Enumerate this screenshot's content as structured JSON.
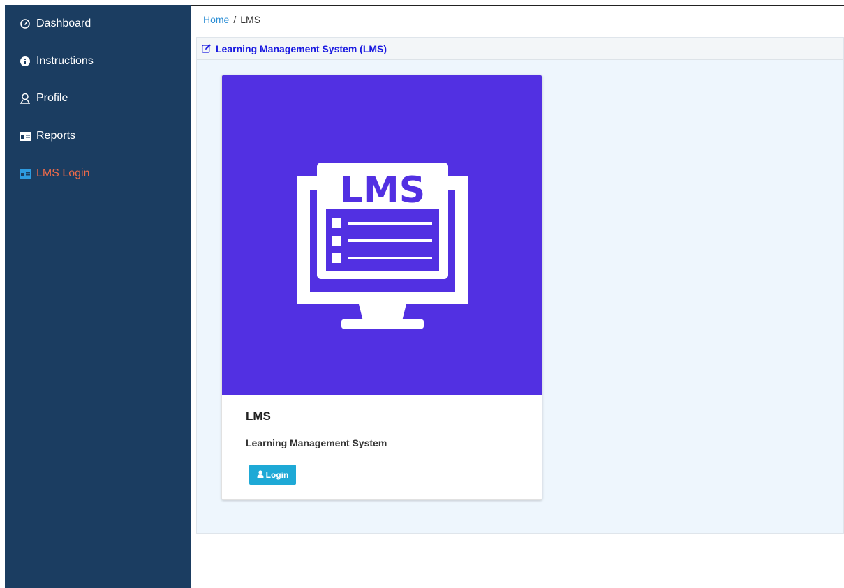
{
  "sidebar": {
    "items": [
      {
        "label": "Dashboard",
        "icon": "dashboard-icon"
      },
      {
        "label": "Instructions",
        "icon": "info-icon"
      },
      {
        "label": "Profile",
        "icon": "user-icon"
      },
      {
        "label": "Reports",
        "icon": "id-card-icon"
      },
      {
        "label": "LMS Login",
        "icon": "id-card-icon",
        "active": true
      }
    ],
    "active_color": "#ef6b4a",
    "background": "#1b3d61"
  },
  "breadcrumb": {
    "home": "Home",
    "separator": "/",
    "current": "LMS"
  },
  "panel": {
    "title": "Learning Management System (LMS)",
    "icon": "edit-icon"
  },
  "card": {
    "image_text": "LMS",
    "title": "LMS",
    "description": "Learning Management System",
    "login_label": "Login",
    "login_icon": "user-icon",
    "image_color": "#5230e2",
    "button_color": "#1ea9d6"
  }
}
